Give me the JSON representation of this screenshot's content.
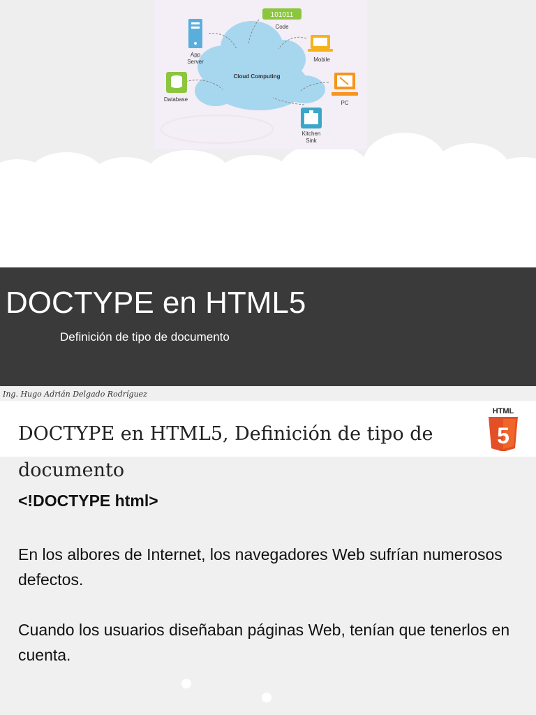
{
  "diagram": {
    "labels": {
      "code_tag": "101011",
      "code": "Code",
      "app_server_1": "App",
      "app_server_2": "Server",
      "mobile": "Mobile",
      "cloud": "Cloud Computing",
      "database": "Database",
      "pc": "PC",
      "kitchen_1": "Kitchen",
      "kitchen_2": "Sink"
    },
    "colors": {
      "cloud": "#a7d7ef",
      "server": "#5aaedc",
      "database": "#8cc63f",
      "mobile": "#f7b21b",
      "pc": "#f7941d",
      "code_tag": "#8cc63f",
      "kitchen": "#3aa6c9"
    }
  },
  "banner": {
    "title": "DOCTYPE en HTML5",
    "subtitle": "Definición de tipo de documento"
  },
  "author": "Ing. Hugo Adrián Delgado Rodríguez",
  "content": {
    "title": "DOCTYPE en HTML5, Definición de tipo de documento",
    "badge_text": "HTML",
    "badge_number": "5",
    "code": "<!DOCTYPE html>",
    "paragraph_1": "En los albores de Internet, los navegadores Web sufrían numerosos defectos.",
    "paragraph_2": "Cuando los usuarios diseñaban páginas Web, tenían que tenerlos en cuenta."
  }
}
